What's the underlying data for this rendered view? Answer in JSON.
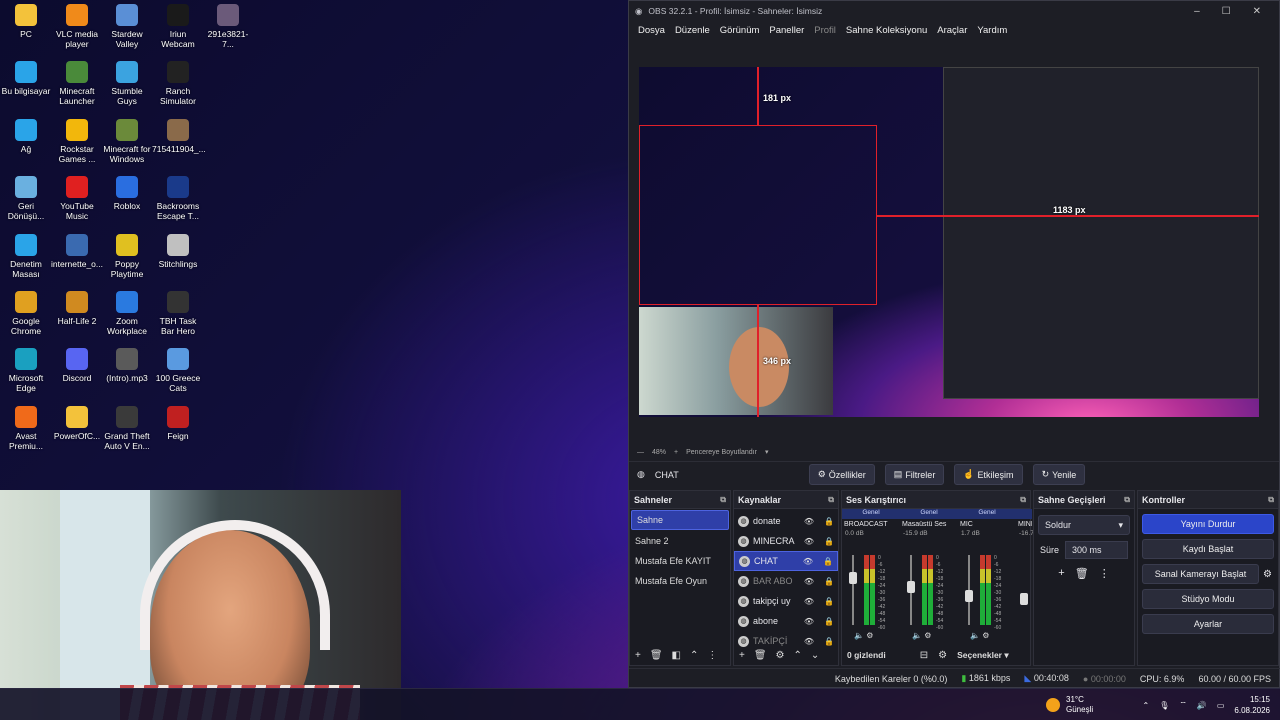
{
  "desktop": {
    "icons": [
      {
        "label": "PC",
        "icon": "folder-icon",
        "color": "#f3c23b"
      },
      {
        "label": "VLC media player",
        "icon": "vlc-icon",
        "color": "#f08a1a"
      },
      {
        "label": "Stardew Valley",
        "icon": "stardew-icon",
        "color": "#5a8fd6"
      },
      {
        "label": "Iriun Webcam",
        "icon": "iriun-icon",
        "color": "#1a1a1a"
      },
      {
        "label": "291e3821-7...",
        "icon": "image-file-icon",
        "color": "#6b5a7a"
      },
      {
        "label": "Bu bilgisayar",
        "icon": "computer-icon",
        "color": "#2aa4e8"
      },
      {
        "label": "Minecraft Launcher",
        "icon": "minecraft-icon",
        "color": "#4a8a3a"
      },
      {
        "label": "Stumble Guys",
        "icon": "stumble-icon",
        "color": "#3ba3e0"
      },
      {
        "label": "Ranch Simulator",
        "icon": "ranch-icon",
        "color": "#222222"
      },
      {
        "label": "Ağ",
        "icon": "network-icon",
        "color": "#2aa4e8"
      },
      {
        "label": "Rockstar Games ...",
        "icon": "rockstar-icon",
        "color": "#f2b70c"
      },
      {
        "label": "Minecraft for Windows",
        "icon": "minecraft-grass-icon",
        "color": "#6b8a3a"
      },
      {
        "label": "715411904_...",
        "icon": "file-icon",
        "color": "#8a6a4a"
      },
      {
        "label": "Geri Dönüşü...",
        "icon": "recycle-bin-icon",
        "color": "#6ab0e0"
      },
      {
        "label": "YouTube Music",
        "icon": "youtube-music-icon",
        "color": "#e02020"
      },
      {
        "label": "Roblox",
        "icon": "roblox-icon",
        "color": "#2a6ee0"
      },
      {
        "label": "Backrooms Escape T...",
        "icon": "backrooms-icon",
        "color": "#1a3a8a"
      },
      {
        "label": "Denetim Masası",
        "icon": "control-panel-icon",
        "color": "#2aa4e8"
      },
      {
        "label": "internette_o...",
        "icon": "file-icon",
        "color": "#3a6ab0"
      },
      {
        "label": "Poppy Playtime",
        "icon": "poppy-icon",
        "color": "#e0c020"
      },
      {
        "label": "Stitchlings",
        "icon": "stitchlings-icon",
        "color": "#c0c0c0"
      },
      {
        "label": "Google Chrome",
        "icon": "chrome-icon",
        "color": "#e0a020"
      },
      {
        "label": "Half-Life 2",
        "icon": "halflife-icon",
        "color": "#d08a20"
      },
      {
        "label": "Zoom Workplace",
        "icon": "zoom-icon",
        "color": "#2a7ae0"
      },
      {
        "label": "TBH Task Bar Hero",
        "icon": "tbh-icon",
        "color": "#333333"
      },
      {
        "label": "Microsoft Edge",
        "icon": "edge-icon",
        "color": "#1aa0c0"
      },
      {
        "label": "Discord",
        "icon": "discord-icon",
        "color": "#5865f2"
      },
      {
        "label": "(Intro).mp3",
        "icon": "audio-file-icon",
        "color": "#5a5a5a"
      },
      {
        "label": "100 Greece Cats",
        "icon": "greece-cats-icon",
        "color": "#5a9ae0"
      },
      {
        "label": "Avast Premiu...",
        "icon": "avast-icon",
        "color": "#f06a1a"
      },
      {
        "label": "PowerOfC...",
        "icon": "folder-icon",
        "color": "#f3c23b"
      },
      {
        "label": "Grand Theft Auto V En...",
        "icon": "gta-icon",
        "color": "#3a3a3a"
      },
      {
        "label": "Feign",
        "icon": "feign-icon",
        "color": "#c02020"
      }
    ]
  },
  "obs": {
    "title": "OBS 32.2.1 - Profil: İsimsiz - Sahneler: İsimsiz",
    "menu": [
      "Dosya",
      "Düzenle",
      "Görünüm",
      "Paneller",
      "Profil",
      "Sahne Koleksiyonu",
      "Araçlar",
      "Yardım"
    ],
    "preview": {
      "labels": [
        "181 px",
        "1183 px",
        "346 px"
      ]
    },
    "zoom": {
      "percent": "48%",
      "fit": "Pencereye Boyutlandır"
    },
    "source_bar": {
      "name": "CHAT",
      "buttons": [
        "Özellikler",
        "Filtreler",
        "Etkileşim",
        "Yenile"
      ]
    },
    "scenes": {
      "title": "Sahneler",
      "items": [
        "Sahne",
        "Sahne 2",
        "Mustafa Efe KAYIT",
        "Mustafa Efe Oyun"
      ],
      "selected": 0
    },
    "sources": {
      "title": "Kaynaklar",
      "items": [
        "donate",
        "MINECRA",
        "CHAT",
        "BAR ABO",
        "takipçi uy",
        "abone",
        "TAKİPÇİ"
      ],
      "selected": 2,
      "dimmed": [
        3,
        6
      ]
    },
    "mixer": {
      "title": "Ses Karıştırıcı",
      "channels": [
        {
          "tag": "Genel",
          "name": "BROADCAST",
          "db": "0.0 dB",
          "level": 0.7
        },
        {
          "tag": "Genel",
          "name": "Masaüstü Ses",
          "db": "-15.9 dB",
          "level": 0.55
        },
        {
          "tag": "Genel",
          "name": "MIC",
          "db": "1.7 dB",
          "level": 0.4
        },
        {
          "tag": "",
          "name": "MINE",
          "db": "-16.7",
          "level": 0.5
        }
      ],
      "scale": [
        "0",
        "-6",
        "-12",
        "-18",
        "-24",
        "-30",
        "-36",
        "-42",
        "-48",
        "-54",
        "-60"
      ],
      "hidden": "0 gizlendi",
      "options": "Seçenekler"
    },
    "transitions": {
      "title": "Sahne Geçişleri",
      "type": "Soldur",
      "duration_label": "Süre",
      "duration": "300 ms"
    },
    "controls": {
      "title": "Kontroller",
      "buttons": [
        "Yayını Durdur",
        "Kaydı Başlat",
        "Sanal Kamerayı Başlat",
        "Stüdyo Modu",
        "Ayarlar"
      ]
    },
    "status": {
      "dropped": "Kaybedilen Kareler 0 (%0.0)",
      "bitrate": "1861 kbps",
      "stream_time": "00:40:08",
      "rec_time": "00:00:00",
      "cpu": "CPU: 6.9%",
      "fps": "60.00 / 60.00 FPS"
    }
  },
  "taskbar": {
    "weather_temp": "31°C",
    "weather_desc": "Güneşli",
    "time": "15:15",
    "date": "6.08.2026"
  }
}
